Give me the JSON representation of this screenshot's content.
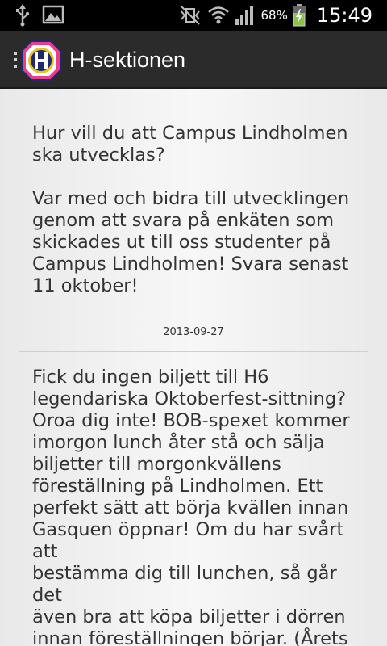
{
  "status_bar": {
    "battery_percent": "68%",
    "time": "15:49",
    "icons": [
      "usb-icon",
      "image-icon",
      "mute-icon",
      "wifi-icon",
      "signal-icon",
      "battery-charging-icon"
    ]
  },
  "action_bar": {
    "title": "H-sektionen",
    "logo_icon": "h-sektionen-logo",
    "colors": {
      "background": "#2b2b2b",
      "logo_pink": "#e83e8c",
      "logo_navy": "#1f2a6b",
      "logo_gold": "#e8c02a"
    }
  },
  "feed": {
    "items": [
      {
        "text": "Hur vill du att Campus Lindholmen\nska utvecklas?\n\nVar med och bidra till utvecklingen\ngenom att svara på enkäten som\nskickades ut till oss studenter på\nCampus Lindholmen! Svara senast\n11 oktober!",
        "date": "2013-09-27"
      },
      {
        "text": "Fick du ingen biljett till H6\nlegendariska Oktoberfest-sittning?\nOroa dig inte! BOB-spexet kommer\nimorgon lunch åter stå och sälja\nbiljetter till morgonkvällens\nföreställning på Lindholmen. Ett\nperfekt sätt att börja kvällen innan\nGasquen öppnar! Om du har svårt att\nbestämma dig till lunchen, så går det\näven bra att köpa biljetter i dörren\ninnan föreställningen börjar. (Årets",
        "date": ""
      }
    ]
  }
}
